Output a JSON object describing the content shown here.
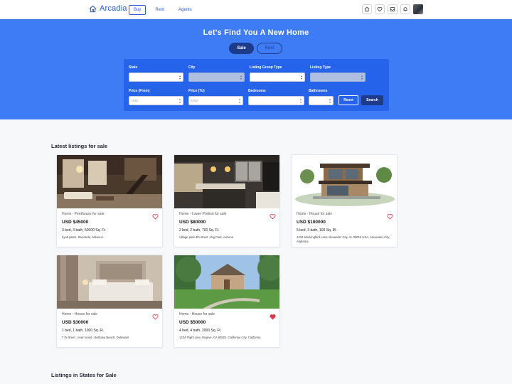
{
  "brand": {
    "name": "Arcadia",
    "color": "#2a5bd7"
  },
  "nav": {
    "tabs": [
      {
        "label": "Buy",
        "active": true
      },
      {
        "label": "Rent",
        "active": false
      },
      {
        "label": "Agents",
        "active": false
      }
    ]
  },
  "header_icons": [
    "home-icon",
    "heart-icon",
    "inbox-icon",
    "bell-icon"
  ],
  "hero": {
    "title": "Let's Find You A New Home",
    "mode": {
      "sale_label": "Sale",
      "rent_label": "Rent",
      "selected": "Sale"
    },
    "filters": {
      "state": {
        "label": "State",
        "value": ""
      },
      "city": {
        "label": "City",
        "value": ""
      },
      "listing_group_type": {
        "label": "Listing Group Type",
        "value": ""
      },
      "listing_type": {
        "label": "Listing Type",
        "value": ""
      },
      "price_from": {
        "label": "Price (From)",
        "value": "USD"
      },
      "price_to": {
        "label": "Price (To)",
        "value": "USD"
      },
      "bedrooms": {
        "label": "Bedrooms",
        "value": ""
      },
      "bathrooms": {
        "label": "Bathrooms",
        "value": ""
      },
      "reset_label": "Reset",
      "search_label": "Search"
    }
  },
  "latest": {
    "title": "Latest listings for sale",
    "listings": [
      {
        "type": "Home - Penthouse for sale",
        "price": "USD  $45000",
        "specs": "3 bed, 3 bath, 50000 Sq. Ft.",
        "address": "hyatt plaze, Riverside, Missouri",
        "favorite": false
      },
      {
        "type": "Home - Lower Portion for sale",
        "price": "USD  $80000",
        "specs": "2 bed, 2 bath, 700 Sq. Ft.",
        "address": "Village park 4th street , Big Park, Arizona",
        "favorite": false
      },
      {
        "type": "Home - House for sale",
        "price": "USD  $100000",
        "specs": "5 bed, 3 bath, 100 Sq. M.",
        "address": "1234 Mockingbird Lane Alexander City, AL 35010 USA, Alexander City, Alabama",
        "favorite": false
      },
      {
        "type": "Home - House for sale",
        "price": "USD  $30000",
        "specs": "1 bed, 1 bath, 1000 Sq. Ft.",
        "address": "7 th street , near round , Bethany Beach, Delaware",
        "favorite": false
      },
      {
        "type": "Home - House for sale",
        "price": "USD  $50000",
        "specs": "4 bed, 4 bath, 2000 Sq. Ft.",
        "address": "1434 Flight Line, Mojave, CA 93501, California City, California",
        "favorite": true
      }
    ]
  },
  "states": {
    "title": "Listings in States for Sale"
  },
  "colors": {
    "hero": "#3d7cf5",
    "filter_panel": "#2563eb",
    "dark_button": "#1e3a8a",
    "heart": "#e0374a"
  }
}
